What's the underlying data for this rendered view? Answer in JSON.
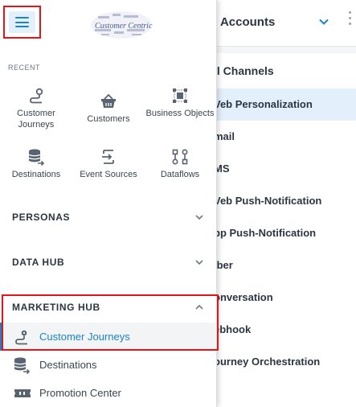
{
  "background": {
    "account_label": "ll Accounts",
    "channels": [
      {
        "label": "ll Channels",
        "active": false
      },
      {
        "label": "Veb Personalization",
        "active": true
      },
      {
        "label": "mail",
        "active": false
      },
      {
        "label": "MS",
        "active": false
      },
      {
        "label": "Veb Push-Notification",
        "active": false
      },
      {
        "label": "pp Push-Notification",
        "active": false
      },
      {
        "label": "iber",
        "active": false
      },
      {
        "label": "onversation",
        "active": false
      },
      {
        "label": "ebhook",
        "active": false
      },
      {
        "label": "ourney Orchestration",
        "active": false
      }
    ]
  },
  "drawer": {
    "logo_text": "Customer Centric",
    "recent_label": "RECENT",
    "recent_tiles": [
      {
        "label": "Customer Journeys",
        "icon": "journey-icon"
      },
      {
        "label": "Customers",
        "icon": "basket-icon"
      },
      {
        "label": "Business Objects",
        "icon": "objects-icon"
      },
      {
        "label": "Destinations",
        "icon": "database-arrow-icon"
      },
      {
        "label": "Event Sources",
        "icon": "event-source-icon"
      },
      {
        "label": "Dataflows",
        "icon": "dataflow-icon"
      }
    ],
    "hubs": [
      {
        "label": "PERSONAS",
        "expanded": false
      },
      {
        "label": "DATA HUB",
        "expanded": false
      },
      {
        "label": "MARKETING HUB",
        "expanded": true
      }
    ],
    "marketing_items": [
      {
        "label": "Customer Journeys",
        "icon": "journey-icon",
        "active": true
      },
      {
        "label": "Destinations",
        "icon": "database-arrow-icon",
        "active": false
      },
      {
        "label": "Promotion Center",
        "icon": "ticket-icon",
        "active": false
      }
    ]
  },
  "colors": {
    "accent": "#1a84c7",
    "highlight": "#e0161b",
    "active_bg": "#e3effb"
  }
}
